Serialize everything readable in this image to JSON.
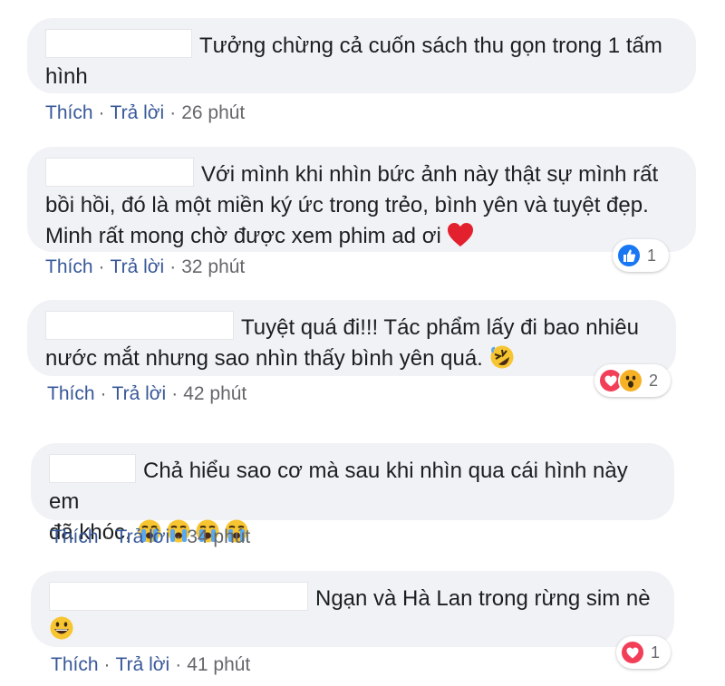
{
  "colors": {
    "bubble_bg": "#f0f2f5",
    "link": "#385898",
    "meta": "#65676b",
    "like_blue": "#1877f2",
    "love_red": "#f33e58",
    "wow_yellow": "#f7b125"
  },
  "actions": {
    "like": "Thích",
    "reply": "Trả lời",
    "dot": "·"
  },
  "comments": [
    {
      "text_line1": "Tưởng chừng cả cuốn sách thu gọn trong 1 tấm",
      "text_line2": "hình",
      "time": "26 phút"
    },
    {
      "text_line1": "Với mình khi nhìn bức ảnh này thật sự mình rất",
      "text_line2": "bồi hồi, đó là một miền ký ức trong trẻo, bình yên và tuyệt đẹp.",
      "text_line3": "Minh rất mong chờ được xem phim ad ơi",
      "emoji": "red-heart",
      "time": "32 phút",
      "reactions": {
        "icons": [
          "like-icon"
        ],
        "count": "1"
      }
    },
    {
      "text_line1": "Tuyệt quá đi!!! Tác phẩm lấy đi bao nhiêu",
      "text_line2": "nước mắt nhưng sao nhìn thấy bình yên quá.",
      "emoji": "rolling-laughing",
      "time": "42 phút",
      "reactions": {
        "icons": [
          "love-icon",
          "wow-icon"
        ],
        "count": "2"
      }
    },
    {
      "text_line1": "Chả hiểu sao cơ mà sau khi nhìn qua cái hình này em",
      "text_line2": "đã khóc,",
      "emoji": "loudly-crying x4",
      "time": "34 phút"
    },
    {
      "text_line1": "Ngạn và Hà Lan trong rừng sim nè",
      "emoji": "grinning-face",
      "time": "41 phút",
      "reactions": {
        "icons": [
          "love-icon"
        ],
        "count": "1"
      }
    }
  ]
}
